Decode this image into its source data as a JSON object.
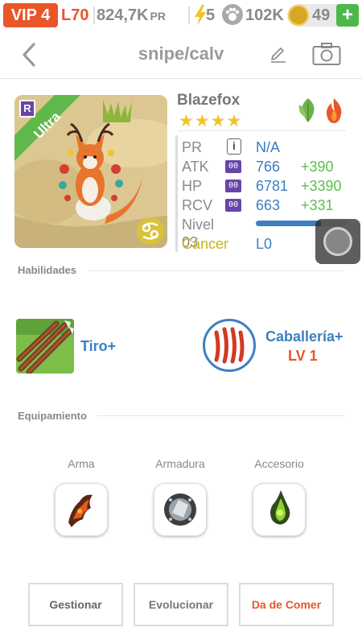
{
  "status_bar": {
    "vip": "VIP 4",
    "level": "L70",
    "pr_value": "824,7K",
    "pr_unit": "PR",
    "energy": "5",
    "food": "102K",
    "coins": "49",
    "plus": "+"
  },
  "header": {
    "title": "snipe/calv",
    "icons": {
      "back": "chevron-left-icon",
      "edit": "pencil-icon",
      "camera": "camera-icon"
    }
  },
  "pet": {
    "name": "Blazefox",
    "stars": "★★★★",
    "star_count": 4,
    "rarity_badge": "R",
    "rarity_ribbon": "Ultra",
    "elements": [
      "leaf-element-icon",
      "fire-element-icon"
    ],
    "stats": {
      "pr": {
        "label": "PR",
        "value": "N/A",
        "icon": "info-icon"
      },
      "atk": {
        "label": "ATK",
        "badge": "00",
        "value": "766",
        "bonus": "+390"
      },
      "hp": {
        "label": "HP",
        "badge": "00",
        "value": "6781",
        "bonus": "+3390"
      },
      "rcv": {
        "label": "RCV",
        "badge": "00",
        "value": "663",
        "bonus": "+331"
      }
    },
    "level_label": "Nivel 03",
    "level_progress": 0.72,
    "zodiac_label": "Cáncer",
    "zodiac_value": "L0"
  },
  "skills": {
    "section_label": "Habilidades",
    "items": [
      {
        "name": "Tiro+",
        "icon": "arrows-skill-icon"
      },
      {
        "name": "Caballería+",
        "level": "LV 1",
        "icon": "claw-skill-icon"
      }
    ]
  },
  "equipment": {
    "section_label": "Equipamiento",
    "slots": [
      {
        "label": "Arma",
        "icon": "weapon-icon"
      },
      {
        "label": "Armadura",
        "icon": "armor-icon"
      },
      {
        "label": "Accesorio",
        "icon": "accessory-icon"
      }
    ]
  },
  "actions": {
    "manage": "Gestionar",
    "evolve": "Evolucionar",
    "feed": "Da de Comer"
  },
  "colors": {
    "accent_orange": "#e8562a",
    "stat_blue": "#3a7ec2",
    "bonus_green": "#5cbf4c",
    "badge_purple": "#6a45a8",
    "star_gold": "#f2c22a",
    "zodiac_gold": "#c9b11c"
  }
}
